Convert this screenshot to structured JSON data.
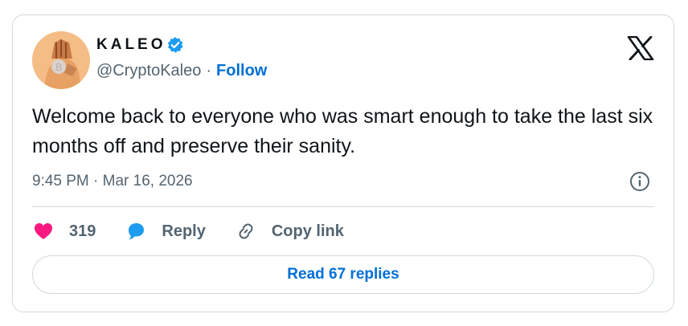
{
  "author": {
    "name": "KALEO",
    "handle": "@CryptoKaleo",
    "separator": "·",
    "follow_label": "Follow",
    "verified": true
  },
  "tweet": {
    "text": "Welcome back to everyone who was smart enough to take the last six months off and preserve their sanity.",
    "timestamp": "9:45 PM · Mar 16, 2026"
  },
  "actions": {
    "likes": "319",
    "reply_label": "Reply",
    "copy_label": "Copy link"
  },
  "read_replies_label": "Read 67 replies",
  "colors": {
    "accent": "#006fd6",
    "like": "#f91880",
    "verified": "#1d9bf0",
    "muted": "#536471",
    "border": "#cfd9de"
  },
  "icons": [
    "verified-badge-icon",
    "x-logo-icon",
    "info-icon",
    "heart-icon",
    "reply-bubble-icon",
    "link-icon"
  ]
}
